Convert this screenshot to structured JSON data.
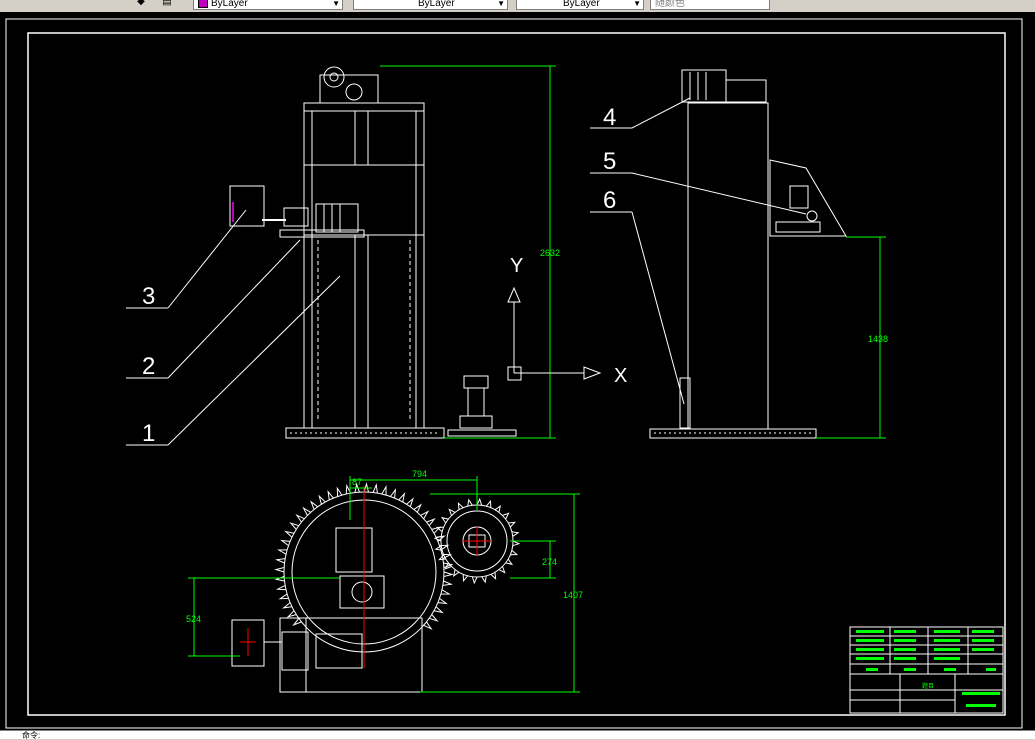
{
  "toolbar": {
    "linetype_combo_1": "ByLayer",
    "linetype_combo_2": "ByLayer",
    "lineweight_combo": "ByLayer",
    "plotstyle_combo": "随颜色",
    "layer_color": "#c000c0"
  },
  "drawing": {
    "background": "#000000",
    "line_color": "#ffffff",
    "dim_color": "#00ff00",
    "callouts": [
      "1",
      "2",
      "3",
      "4",
      "5",
      "6"
    ],
    "axis_x": "X",
    "axis_y": "Y",
    "dims": {
      "overall_height": "2632",
      "right_height": "1438",
      "gear_distance": "794",
      "small_offset": "87",
      "gear_offset": "274",
      "plan_height": "1407",
      "plan_offset": "524"
    },
    "title_block": {
      "name_label": "题目"
    }
  },
  "statusbar": {
    "text": "命令:"
  }
}
